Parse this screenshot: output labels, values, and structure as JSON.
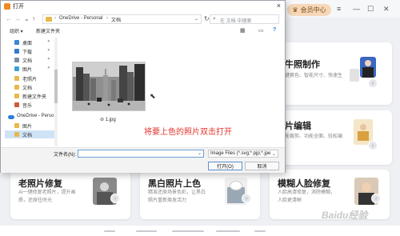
{
  "dialog": {
    "title": "打开",
    "close_glyph": "×",
    "nav": {
      "back": "←",
      "forward": "→",
      "down": "⌄",
      "up": "↑"
    },
    "breadcrumb": [
      "OneDrive - Personal",
      "文档"
    ],
    "breadcrumb_separator": "›",
    "refresh_glyph": "↻",
    "search_placeholder": "在 文档 中搜索",
    "toolbar": {
      "organize": "组织 ▾",
      "new_folder": "新建文件夹"
    },
    "sidebar": [
      {
        "label": "桌面",
        "icon": "desktop-icon",
        "color": "#3a86d6",
        "pinned": true
      },
      {
        "label": "下载",
        "icon": "download-icon",
        "color": "#2f7bd0",
        "pinned": true
      },
      {
        "label": "文档",
        "icon": "documents-icon",
        "color": "#7d8ea3",
        "pinned": true
      },
      {
        "label": "图片",
        "icon": "pictures-icon",
        "color": "#3aa0d8",
        "pinned": true
      },
      {
        "label": "老照片",
        "icon": "folder-icon",
        "color": "#e8b84a",
        "pinned": false
      },
      {
        "label": "文档",
        "icon": "folder-icon",
        "color": "#e8b84a",
        "pinned": false
      },
      {
        "label": "新建文件夹",
        "icon": "folder-icon",
        "color": "#e8b84a",
        "pinned": false
      },
      {
        "label": "音乐",
        "icon": "music-icon",
        "color": "#d05a3a",
        "pinned": false
      },
      {
        "label": "OneDrive - Perso",
        "icon": "onedrive-icon",
        "color": "#2d7fd6",
        "pinned": false
      },
      {
        "label": "图片",
        "icon": "folder-icon",
        "color": "#e8b84a",
        "pinned": false
      },
      {
        "label": "文档",
        "icon": "folder-icon",
        "color": "#e8b84a",
        "pinned": false,
        "selected": true
      }
    ],
    "file": {
      "name": "1.jpg",
      "prefix": "⊘"
    },
    "instruction": "将要上色的照片双击打开",
    "filename_label": "文件名(N):",
    "filename_value": "",
    "filetype": "Image Files (*.svg;*.pjp;*.jpe",
    "open_button": "打开(O)",
    "cancel_button": "取消"
  },
  "app": {
    "vip_label": "会员中心",
    "cards": [
      {
        "title": "证件照制作",
        "desc": "一键换色、智能尺寸、快速生成",
        "title_visible": "牛照制作"
      },
      {
        "title": "照片编辑",
        "desc": "智能裁剪、功能全面、轻松编辑",
        "title_visible": "片编辑"
      },
      {
        "title": "老照片修复",
        "desc": "AI一键修复老照片，提升画质，还原往时光"
      },
      {
        "title": "黑白照片上色",
        "desc": "精准还原场景色彩，让黑白照片重新焕发活力"
      },
      {
        "title": "模糊人脸修复",
        "desc": "人脸高清修复，消除模糊，人脸更清晰"
      }
    ],
    "watermark": "Baidu经验"
  },
  "colors": {
    "accent_red": "#e0342c",
    "vip_bg": "#f6d8b8"
  }
}
